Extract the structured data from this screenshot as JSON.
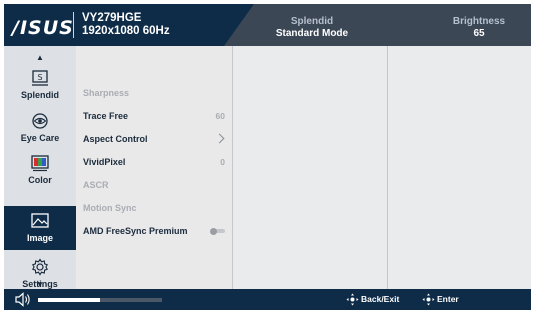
{
  "header": {
    "brand": "/ISUS",
    "model": "VY279HGE",
    "resolution": "1920x1080 60Hz",
    "splendid_label": "Splendid",
    "splendid_value": "Standard Mode",
    "brightness_label": "Brightness",
    "brightness_value": "65"
  },
  "sidebar": {
    "items": [
      {
        "label": "Splendid",
        "icon": "splendid-icon",
        "active": false
      },
      {
        "label": "Eye Care",
        "icon": "eye-care-icon",
        "active": false
      },
      {
        "label": "Color",
        "icon": "color-icon",
        "active": false
      },
      {
        "label": "Image",
        "icon": "image-icon",
        "active": true
      },
      {
        "label": "Settings",
        "icon": "settings-gear-icon",
        "active": false
      }
    ]
  },
  "image_menu": {
    "items": [
      {
        "label": "Sharpness",
        "enabled": false,
        "value": ""
      },
      {
        "label": "Trace Free",
        "enabled": true,
        "value": "60"
      },
      {
        "label": "Aspect Control",
        "enabled": true,
        "value": ""
      },
      {
        "label": "VividPixel",
        "enabled": true,
        "value": "0"
      },
      {
        "label": "ASCR",
        "enabled": false,
        "value": ""
      },
      {
        "label": "Motion Sync",
        "enabled": false,
        "value": ""
      },
      {
        "label": "AMD FreeSync Premium",
        "enabled": true,
        "value": ""
      }
    ],
    "freesync_on": false
  },
  "footer": {
    "volume_level": 0.5,
    "back_label": "Back/Exit",
    "enter_label": "Enter"
  },
  "colors": {
    "header_dark": "#0e2c48",
    "header_mid": "#3c4756",
    "active_bg": "#0e2c48",
    "panel_bg": "#e9e9ea"
  }
}
